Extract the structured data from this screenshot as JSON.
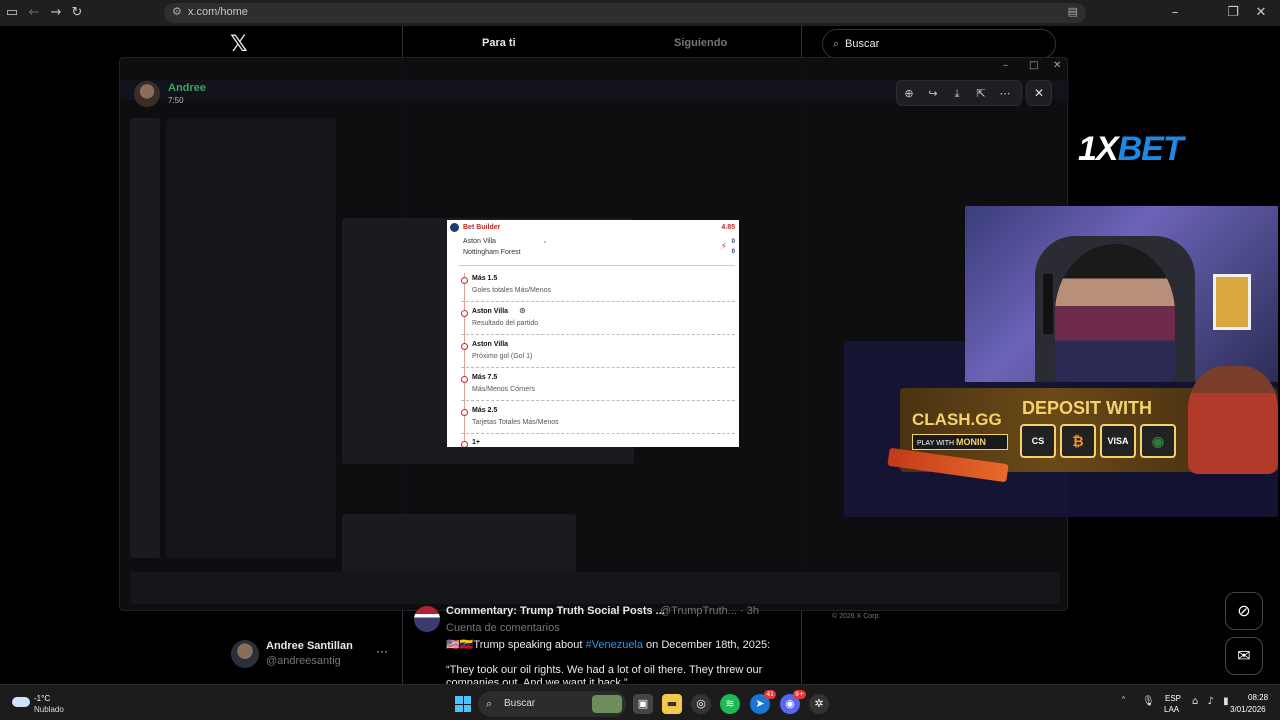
{
  "browser": {
    "url": "x.com/home"
  },
  "x": {
    "tabs": [
      {
        "label": "Para ti"
      },
      {
        "label": "Siguiendo"
      }
    ],
    "search_placeholder": "Buscar",
    "account": {
      "name": "Andree Santillan",
      "handle": "@andreesantig",
      "more": "···"
    },
    "post": {
      "title": "Commentary: Trump Truth Social Posts ...",
      "handle": "@TrumpTruth... · 3h",
      "context": "Cuenta de comentarios",
      "line1_prefix": "🇺🇸🇻🇪Trump speaking about ",
      "line1_tag": "#Venezuela",
      "line1_suffix": " on December 18th, 2025:",
      "line2": "“They took our oil rights. We had a lot of oil there. They threw our",
      "line3": "companies out. And we want it back.”"
    },
    "copyright": "© 2026 X Corp."
  },
  "viewer": {
    "sender_name": "Andree",
    "sender_time": "7:50"
  },
  "bet": {
    "title": "Bet Builder",
    "odds": "4.85",
    "home_team": "Aston Villa",
    "away_team": "Nottingham Forest",
    "home_score": "0",
    "away_score": "0",
    "selections": [
      {
        "pick": "Más 1.5",
        "market": "Goles totales Más/Menos"
      },
      {
        "pick": "Aston Villa",
        "market": "Resultado del partido"
      },
      {
        "pick": "Aston Villa",
        "market": "Próximo gol (Gol 1)"
      },
      {
        "pick": "Más 7.5",
        "market": "Más/Menos Córners"
      },
      {
        "pick": "Más 2.5",
        "market": "Tarjetas Totales Más/Menos"
      },
      {
        "pick": "1+",
        "market": ""
      }
    ]
  },
  "ads": {
    "xbet_prefix": "1X",
    "xbet_suffix": "BET",
    "clash_logo": "CLASH.GG",
    "play_with": "PLAY WITH",
    "play_name": "MONIN",
    "deposit": "DEPOSIT WITH",
    "payments": [
      "CS",
      "₿",
      "VISA",
      "◉"
    ]
  },
  "taskbar": {
    "temp": "-1°C",
    "weather": "Nublado",
    "search": "Buscar",
    "lang1": "ESP",
    "lang2": "LAA",
    "time": "08:28",
    "date": "3/01/2026",
    "badges": {
      "app1": "41",
      "app2": "9+"
    }
  },
  "icons": [
    "sidebar-toggle-icon",
    "back-icon",
    "forward-icon",
    "reload-icon",
    "site-info-icon",
    "reader-mode-icon",
    "zoom-icon",
    "share-icon",
    "download-icon",
    "open-external-icon",
    "more-icon",
    "close-icon",
    "grok-icon",
    "mail-icon",
    "search-icon",
    "windows-start-icon"
  ]
}
